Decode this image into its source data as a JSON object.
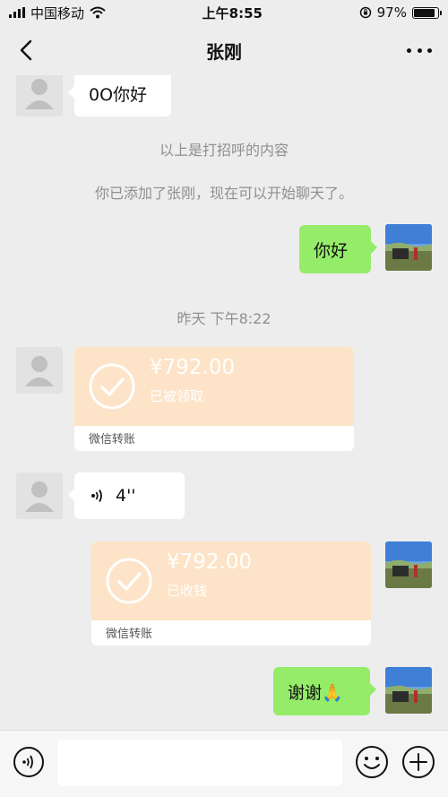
{
  "status_bar": {
    "carrier": "中国移动",
    "time": "上午8:55",
    "battery_percent": "97%",
    "battery_level": 0.97
  },
  "nav": {
    "title": "张刚"
  },
  "messages": {
    "greeting_text": "0O你好",
    "system_greeting_note": "以上是打招呼的内容",
    "system_added_note": "你已添加了张刚，现在可以开始聊天了。",
    "my_hello": "你好",
    "timestamp": "昨天 下午8:22",
    "transfer_incoming": {
      "amount": "¥792.00",
      "status": "已被领取",
      "footer": "微信转账"
    },
    "voice_duration": "4''",
    "transfer_outgoing": {
      "amount": "¥792.00",
      "status": "已收钱",
      "footer": "微信转账"
    },
    "thanks": "谢谢🙏"
  },
  "input": {
    "value": ""
  },
  "colors": {
    "background": "#ededed",
    "my_bubble": "#95ec69",
    "other_bubble": "#ffffff",
    "transfer": "#fde3c7",
    "system_text": "#8f8f8f"
  }
}
